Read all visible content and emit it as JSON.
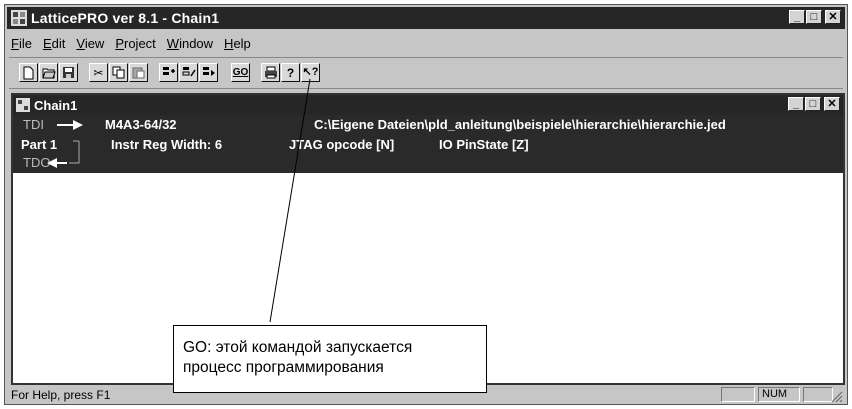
{
  "app": {
    "title": "LatticePRO ver 8.1 - Chain1",
    "window_buttons": [
      "_",
      "□",
      "✕"
    ]
  },
  "menu": [
    "File",
    "Edit",
    "View",
    "Project",
    "Window",
    "Help"
  ],
  "toolbar": {
    "go_label": "GO",
    "buttons": [
      "new",
      "open",
      "save",
      "cut",
      "copy",
      "paste",
      "chain-add",
      "chain-edit",
      "chain-run",
      "go",
      "print",
      "help",
      "context-help"
    ]
  },
  "child_window": {
    "title": "Chain1"
  },
  "chain": {
    "tdi": "TDI",
    "tdo": "TDO",
    "part": "Part  1",
    "device": "M4A3-64/32",
    "path": "C:\\Eigene Dateien\\pld_anleitung\\beispiele\\hierarchie\\hierarchie.jed",
    "instr_reg": "Instr Reg Width:  6",
    "jtag_opcode": "JTAG opcode [N]",
    "io_pinstate": "IO PinState [Z]"
  },
  "callout": {
    "line1": "GO: этой командой запускается",
    "line2": "процесс программирования"
  },
  "status": {
    "help": "For Help, press F1",
    "num": "NUM"
  }
}
